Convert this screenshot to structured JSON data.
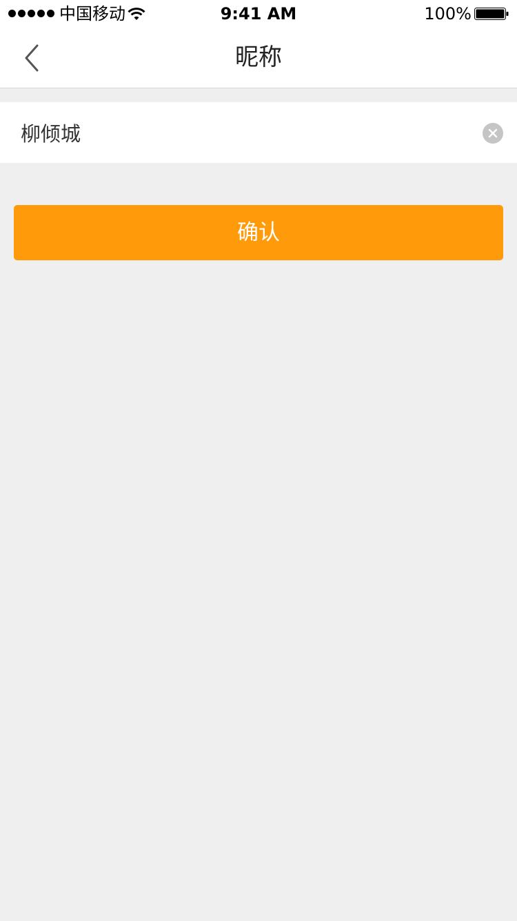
{
  "status_bar": {
    "carrier": "中国移动",
    "time": "9:41 AM",
    "battery_percent": "100%",
    "icons": [
      "signal-dots",
      "wifi-icon",
      "battery-icon"
    ]
  },
  "nav": {
    "title": "昵称",
    "back_icon": "chevron-left-icon"
  },
  "form": {
    "nickname_value": "柳倾城",
    "clear_icon": "clear-icon"
  },
  "actions": {
    "confirm_label": "确认"
  },
  "colors": {
    "accent": "#ff9b0a",
    "background": "#efefef",
    "surface": "#ffffff",
    "clear_button": "#c5c5c5"
  }
}
